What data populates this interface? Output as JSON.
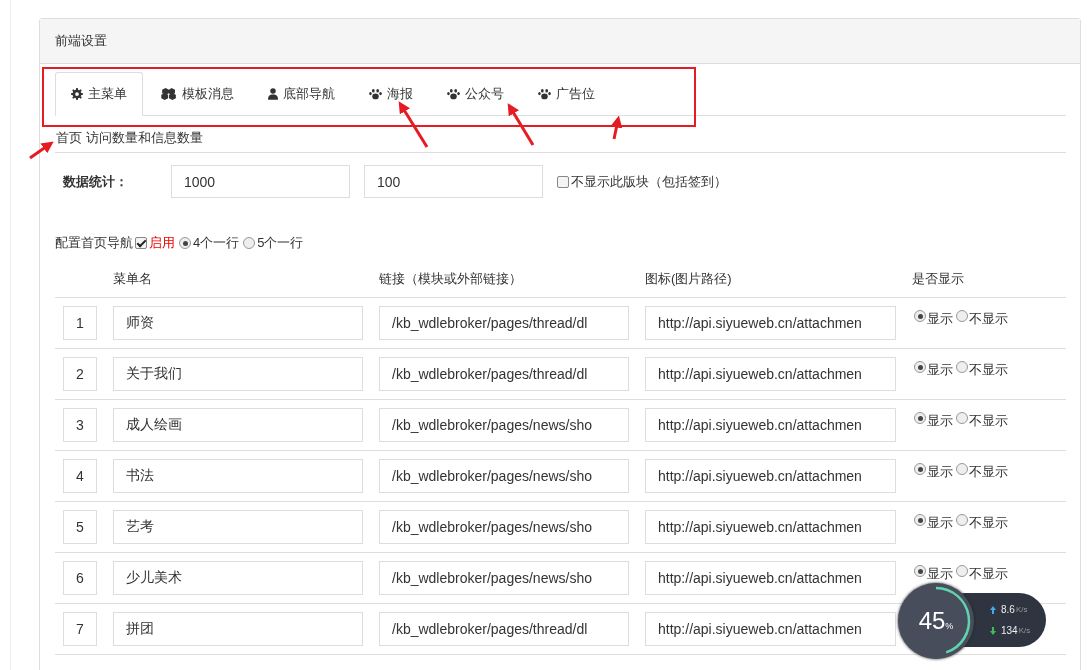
{
  "panel": {
    "title": "前端设置"
  },
  "tabs": [
    {
      "label": "主菜单",
      "selected": true
    },
    {
      "label": "模板消息",
      "selected": false
    },
    {
      "label": "底部导航",
      "selected": false
    },
    {
      "label": "海报",
      "selected": false
    },
    {
      "label": "公众号",
      "selected": false
    },
    {
      "label": "广告位",
      "selected": false
    }
  ],
  "section_title": "首页 访问数量和信息数量",
  "stats": {
    "label": "数据统计：",
    "values": [
      "1000",
      "100"
    ],
    "hide_option": {
      "label": "不显示此版块（包括签到）",
      "checked": false
    }
  },
  "nav_config": {
    "label": "配置首页导航",
    "enable": {
      "label": "启用",
      "checked": true
    },
    "layouts": [
      {
        "label": "4个一行",
        "selected": true
      },
      {
        "label": "5个一行",
        "selected": false
      }
    ]
  },
  "table": {
    "columns": [
      "菜单名",
      "链接（模块或外部链接）",
      "图标(图片路径)",
      "是否显示"
    ],
    "rows": [
      {
        "index": "1",
        "name": "师资",
        "link": "/kb_wdlebroker/pages/thread/dl",
        "icon_path": "http://api.siyueweb.cn/attachmen",
        "display": [
          {
            "label": "显示",
            "selected": true
          },
          {
            "label": "不显示",
            "selected": false
          }
        ]
      },
      {
        "index": "2",
        "name": "关于我们",
        "link": "/kb_wdlebroker/pages/thread/dl",
        "icon_path": "http://api.siyueweb.cn/attachmen",
        "display": [
          {
            "label": "显示",
            "selected": true
          },
          {
            "label": "不显示",
            "selected": false
          }
        ]
      },
      {
        "index": "3",
        "name": "成人绘画",
        "link": "/kb_wdlebroker/pages/news/sho",
        "icon_path": "http://api.siyueweb.cn/attachmen",
        "display": [
          {
            "label": "显示",
            "selected": true
          },
          {
            "label": "不显示",
            "selected": false
          }
        ]
      },
      {
        "index": "4",
        "name": "书法",
        "link": "/kb_wdlebroker/pages/news/sho",
        "icon_path": "http://api.siyueweb.cn/attachmen",
        "display": [
          {
            "label": "显示",
            "selected": true
          },
          {
            "label": "不显示",
            "selected": false
          }
        ]
      },
      {
        "index": "5",
        "name": "艺考",
        "link": "/kb_wdlebroker/pages/news/sho",
        "icon_path": "http://api.siyueweb.cn/attachmen",
        "display": [
          {
            "label": "显示",
            "selected": true
          },
          {
            "label": "不显示",
            "selected": false
          }
        ]
      },
      {
        "index": "6",
        "name": "少儿美术",
        "link": "/kb_wdlebroker/pages/news/sho",
        "icon_path": "http://api.siyueweb.cn/attachmen",
        "display": [
          {
            "label": "显示",
            "selected": true
          },
          {
            "label": "不显示",
            "selected": false
          }
        ]
      },
      {
        "index": "7",
        "name": "拼团",
        "link": "/kb_wdlebroker/pages/thread/dl",
        "icon_path": "http://api.siyueweb.cn/attachmen"
      }
    ]
  },
  "speed_widget": {
    "percent": "45",
    "percent_sign": "%",
    "level": 0.45,
    "upload": "8.6",
    "upload_unit": "K/s",
    "download": "134",
    "download_unit": "K/s"
  }
}
